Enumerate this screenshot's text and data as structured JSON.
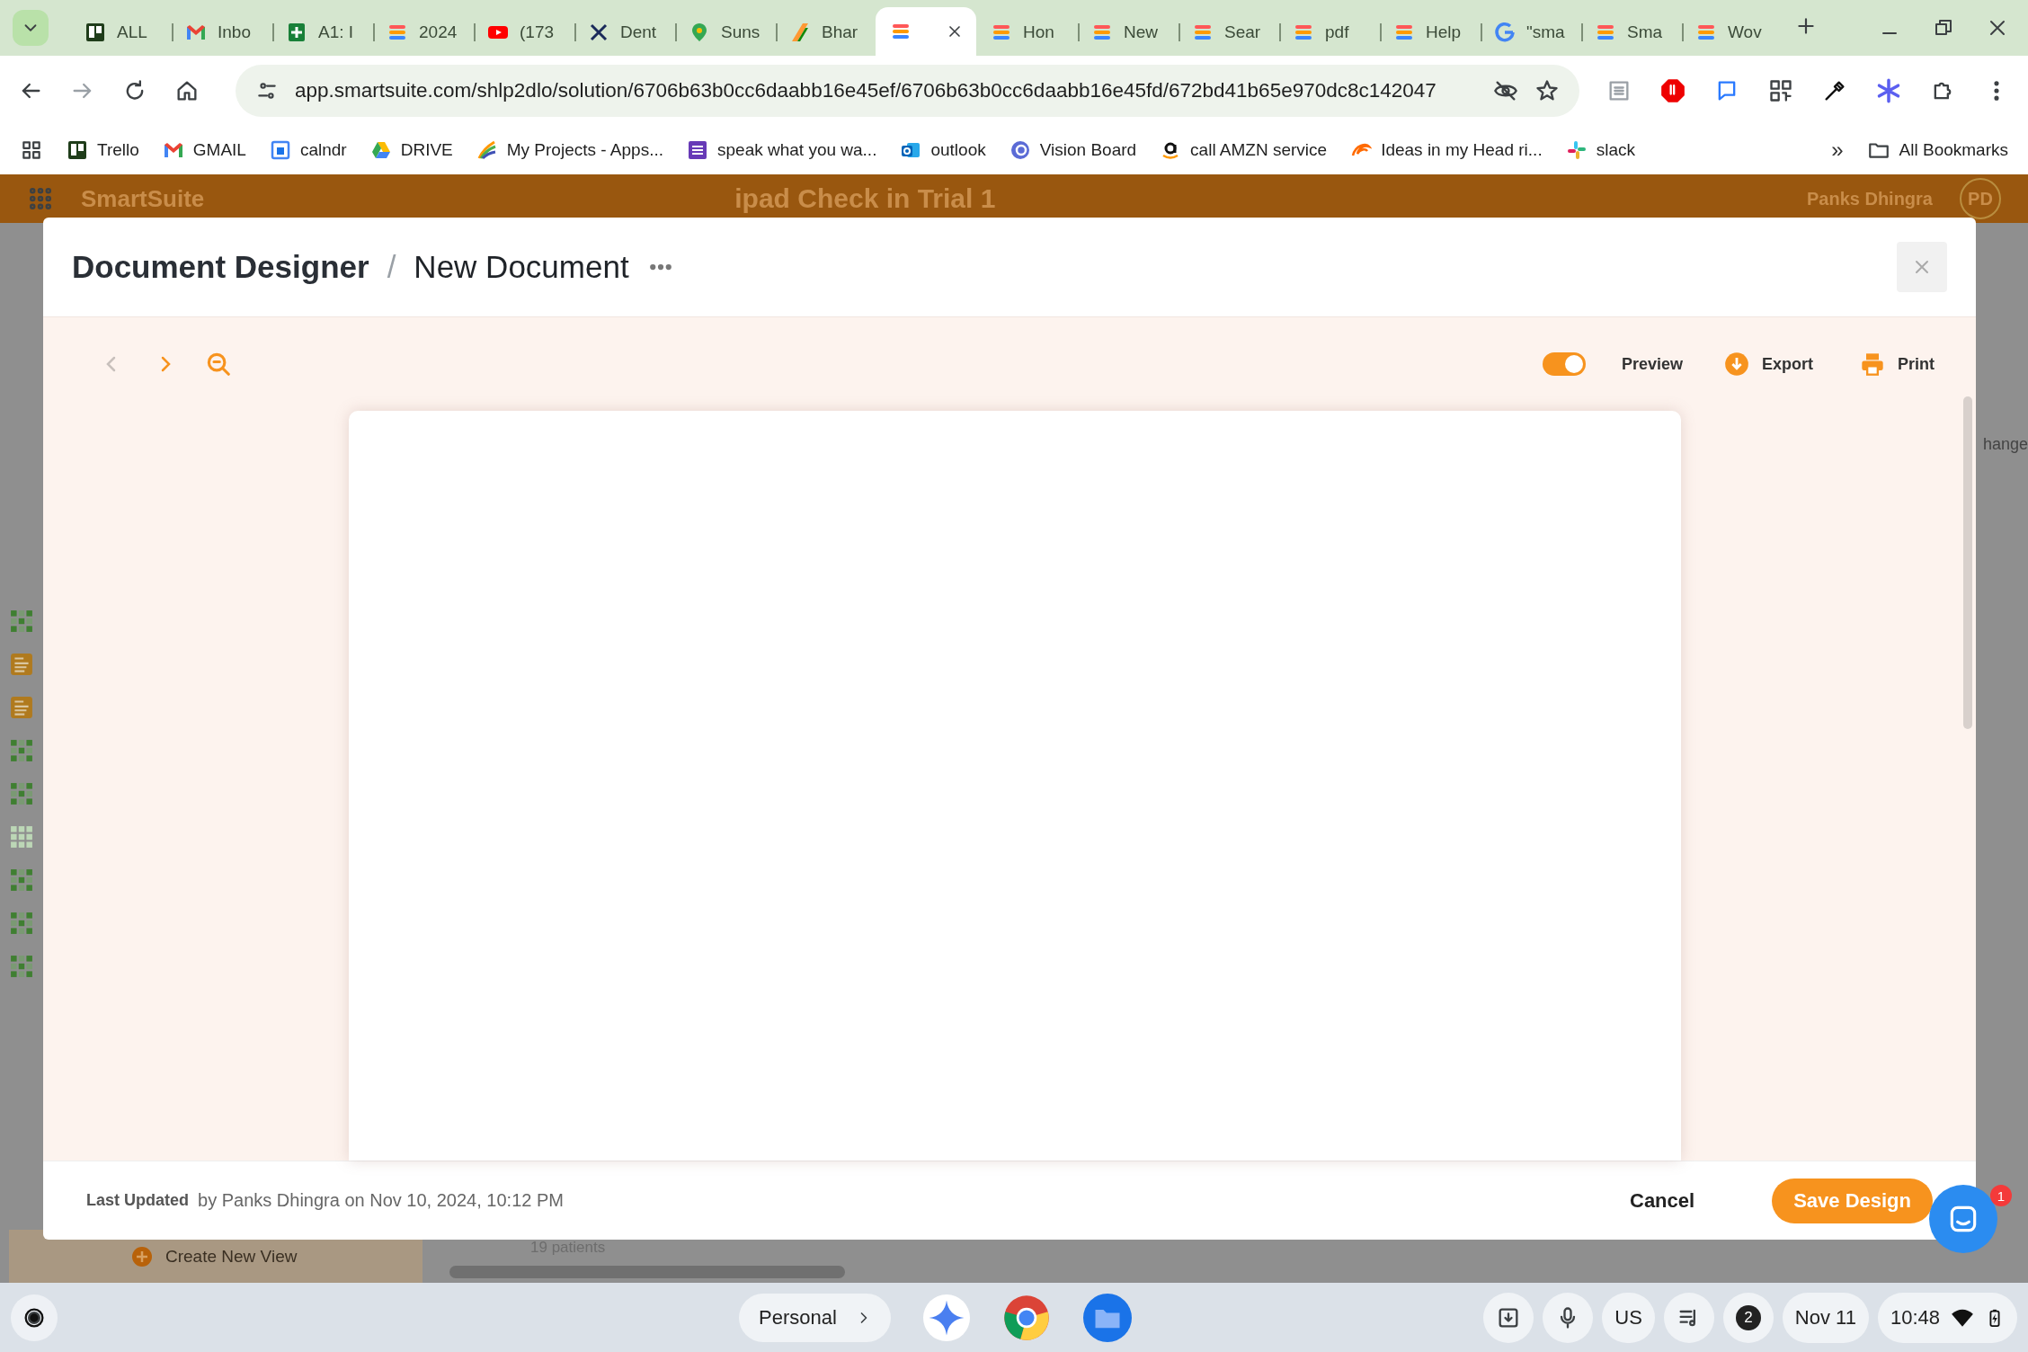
{
  "browser": {
    "tabs": [
      {
        "title": "ALL",
        "kind": "trello",
        "selected": false
      },
      {
        "title": "Inbo",
        "kind": "gmail",
        "selected": false
      },
      {
        "title": "A1: I",
        "kind": "sheets",
        "selected": false
      },
      {
        "title": "2024",
        "kind": "smartsuite",
        "selected": false
      },
      {
        "title": "(173",
        "kind": "youtube",
        "selected": false
      },
      {
        "title": "Dent",
        "kind": "x",
        "selected": false
      },
      {
        "title": "Suns",
        "kind": "maps",
        "selected": false
      },
      {
        "title": "Bhar",
        "kind": "flag",
        "selected": false
      },
      {
        "kind": "smartsuite",
        "selected": true
      },
      {
        "title": "Hon",
        "kind": "smartsuite",
        "selected": false
      },
      {
        "title": "New",
        "kind": "smartsuite",
        "selected": false
      },
      {
        "title": "Sear",
        "kind": "smartsuite",
        "selected": false
      },
      {
        "title": "pdf",
        "kind": "smartsuite",
        "selected": false
      },
      {
        "title": "Help",
        "kind": "smartsuite",
        "selected": false
      },
      {
        "title": "\"sma",
        "kind": "google",
        "selected": false
      },
      {
        "title": "Sma",
        "kind": "smartsuite",
        "selected": false
      },
      {
        "title": "Wov",
        "kind": "smartsuite",
        "selected": false
      }
    ],
    "address": "app.smartsuite.com/shlp2dlo/solution/6706b63b0cc6daabb16e45ef/6706b63b0cc6daabb16e45fd/672bd41b65e970dc8c142047",
    "bookmarks": [
      {
        "label": "Trello",
        "kind": "trello"
      },
      {
        "label": "GMAIL",
        "kind": "gmail"
      },
      {
        "label": "calndr",
        "kind": "calendar"
      },
      {
        "label": "DRIVE",
        "kind": "drive"
      },
      {
        "label": "My Projects - Apps...",
        "kind": "paint"
      },
      {
        "label": "speak what you wa...",
        "kind": "list"
      },
      {
        "label": "outlook",
        "kind": "outlook"
      },
      {
        "label": "Vision Board",
        "kind": "circle"
      },
      {
        "label": "call AMZN service",
        "kind": "amazon"
      },
      {
        "label": "Ideas in my Head ri...",
        "kind": "swirl"
      },
      {
        "label": "slack",
        "kind": "slack"
      }
    ],
    "more_bookmarks": "»",
    "all_bookmarks": "All Bookmarks"
  },
  "app": {
    "brand": "SmartSuite",
    "workspace": "ipad Check in Trial 1",
    "user": "Panks Dhingra",
    "initials": "PD",
    "create_view": "Create New View",
    "record_count": "19 patients",
    "edge_text": "hange"
  },
  "modal": {
    "breadcrumb": [
      "Document Designer",
      "New Document"
    ],
    "separator": "/",
    "nav": [
      {
        "kind": "prev",
        "disabled": true
      },
      {
        "kind": "next",
        "disabled": false
      }
    ],
    "preview": {
      "label": "Preview",
      "on": true
    },
    "actions": [
      {
        "kind": "export",
        "label": "Export"
      },
      {
        "kind": "print",
        "label": "Print"
      }
    ],
    "last_updated_label": "Last Updated",
    "last_updated": "by Panks Dhingra on Nov 10, 2024, 10:12 PM",
    "cancel": "Cancel",
    "save": "Save Design"
  },
  "chat": {
    "badge": "1"
  },
  "taskbar": {
    "profile": "Personal",
    "tray": {
      "keyboard": "US",
      "notifications": "2",
      "date": "Nov 11",
      "time": "10:48"
    }
  }
}
